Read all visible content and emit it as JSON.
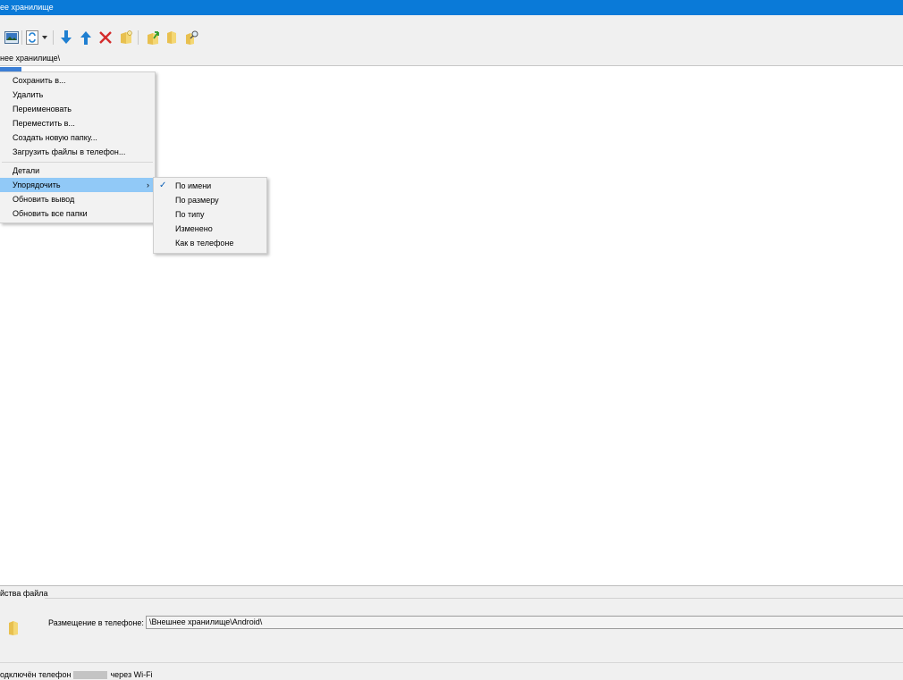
{
  "window": {
    "title": "ее хранилище"
  },
  "toolbar": {
    "buttons": [
      {
        "name": "picture-icon"
      },
      {
        "name": "refresh-icon"
      },
      {
        "name": "dropdown-arrow-icon"
      },
      {
        "name": "download-arrow-icon"
      },
      {
        "name": "upload-arrow-icon"
      },
      {
        "name": "delete-x-icon"
      },
      {
        "name": "folder-new-icon"
      },
      {
        "name": "folder-upload-icon"
      },
      {
        "name": "folder-icon"
      },
      {
        "name": "folder-search-icon"
      }
    ]
  },
  "path": {
    "current": "нее хранилище\\"
  },
  "context_menu": {
    "items": [
      "Сохранить в...",
      "Удалить",
      "Переименовать",
      "Переместить в...",
      "Создать новую папку...",
      "Загрузить файлы в телефон..."
    ],
    "items2": [
      "Детали",
      "Упорядочить",
      "Обновить вывод",
      "Обновить все папки"
    ],
    "submenu_arrow": "›"
  },
  "sort_submenu": {
    "items": [
      "По имени",
      "По размеру",
      "По типу",
      "Изменено",
      "Как в телефоне"
    ],
    "checked_index": 0,
    "check_glyph": "✓"
  },
  "properties": {
    "title": "йства файла",
    "location_label": "Размещение в телефоне:",
    "location_value": "\\Внешнее хранилище\\Android\\"
  },
  "status": {
    "prefix": "одключён телефон",
    "suffix": "через Wi-Fi"
  },
  "colors": {
    "accent": "#0a7ad8",
    "highlight": "#91c9f7",
    "selection": "#3c7fd6"
  }
}
